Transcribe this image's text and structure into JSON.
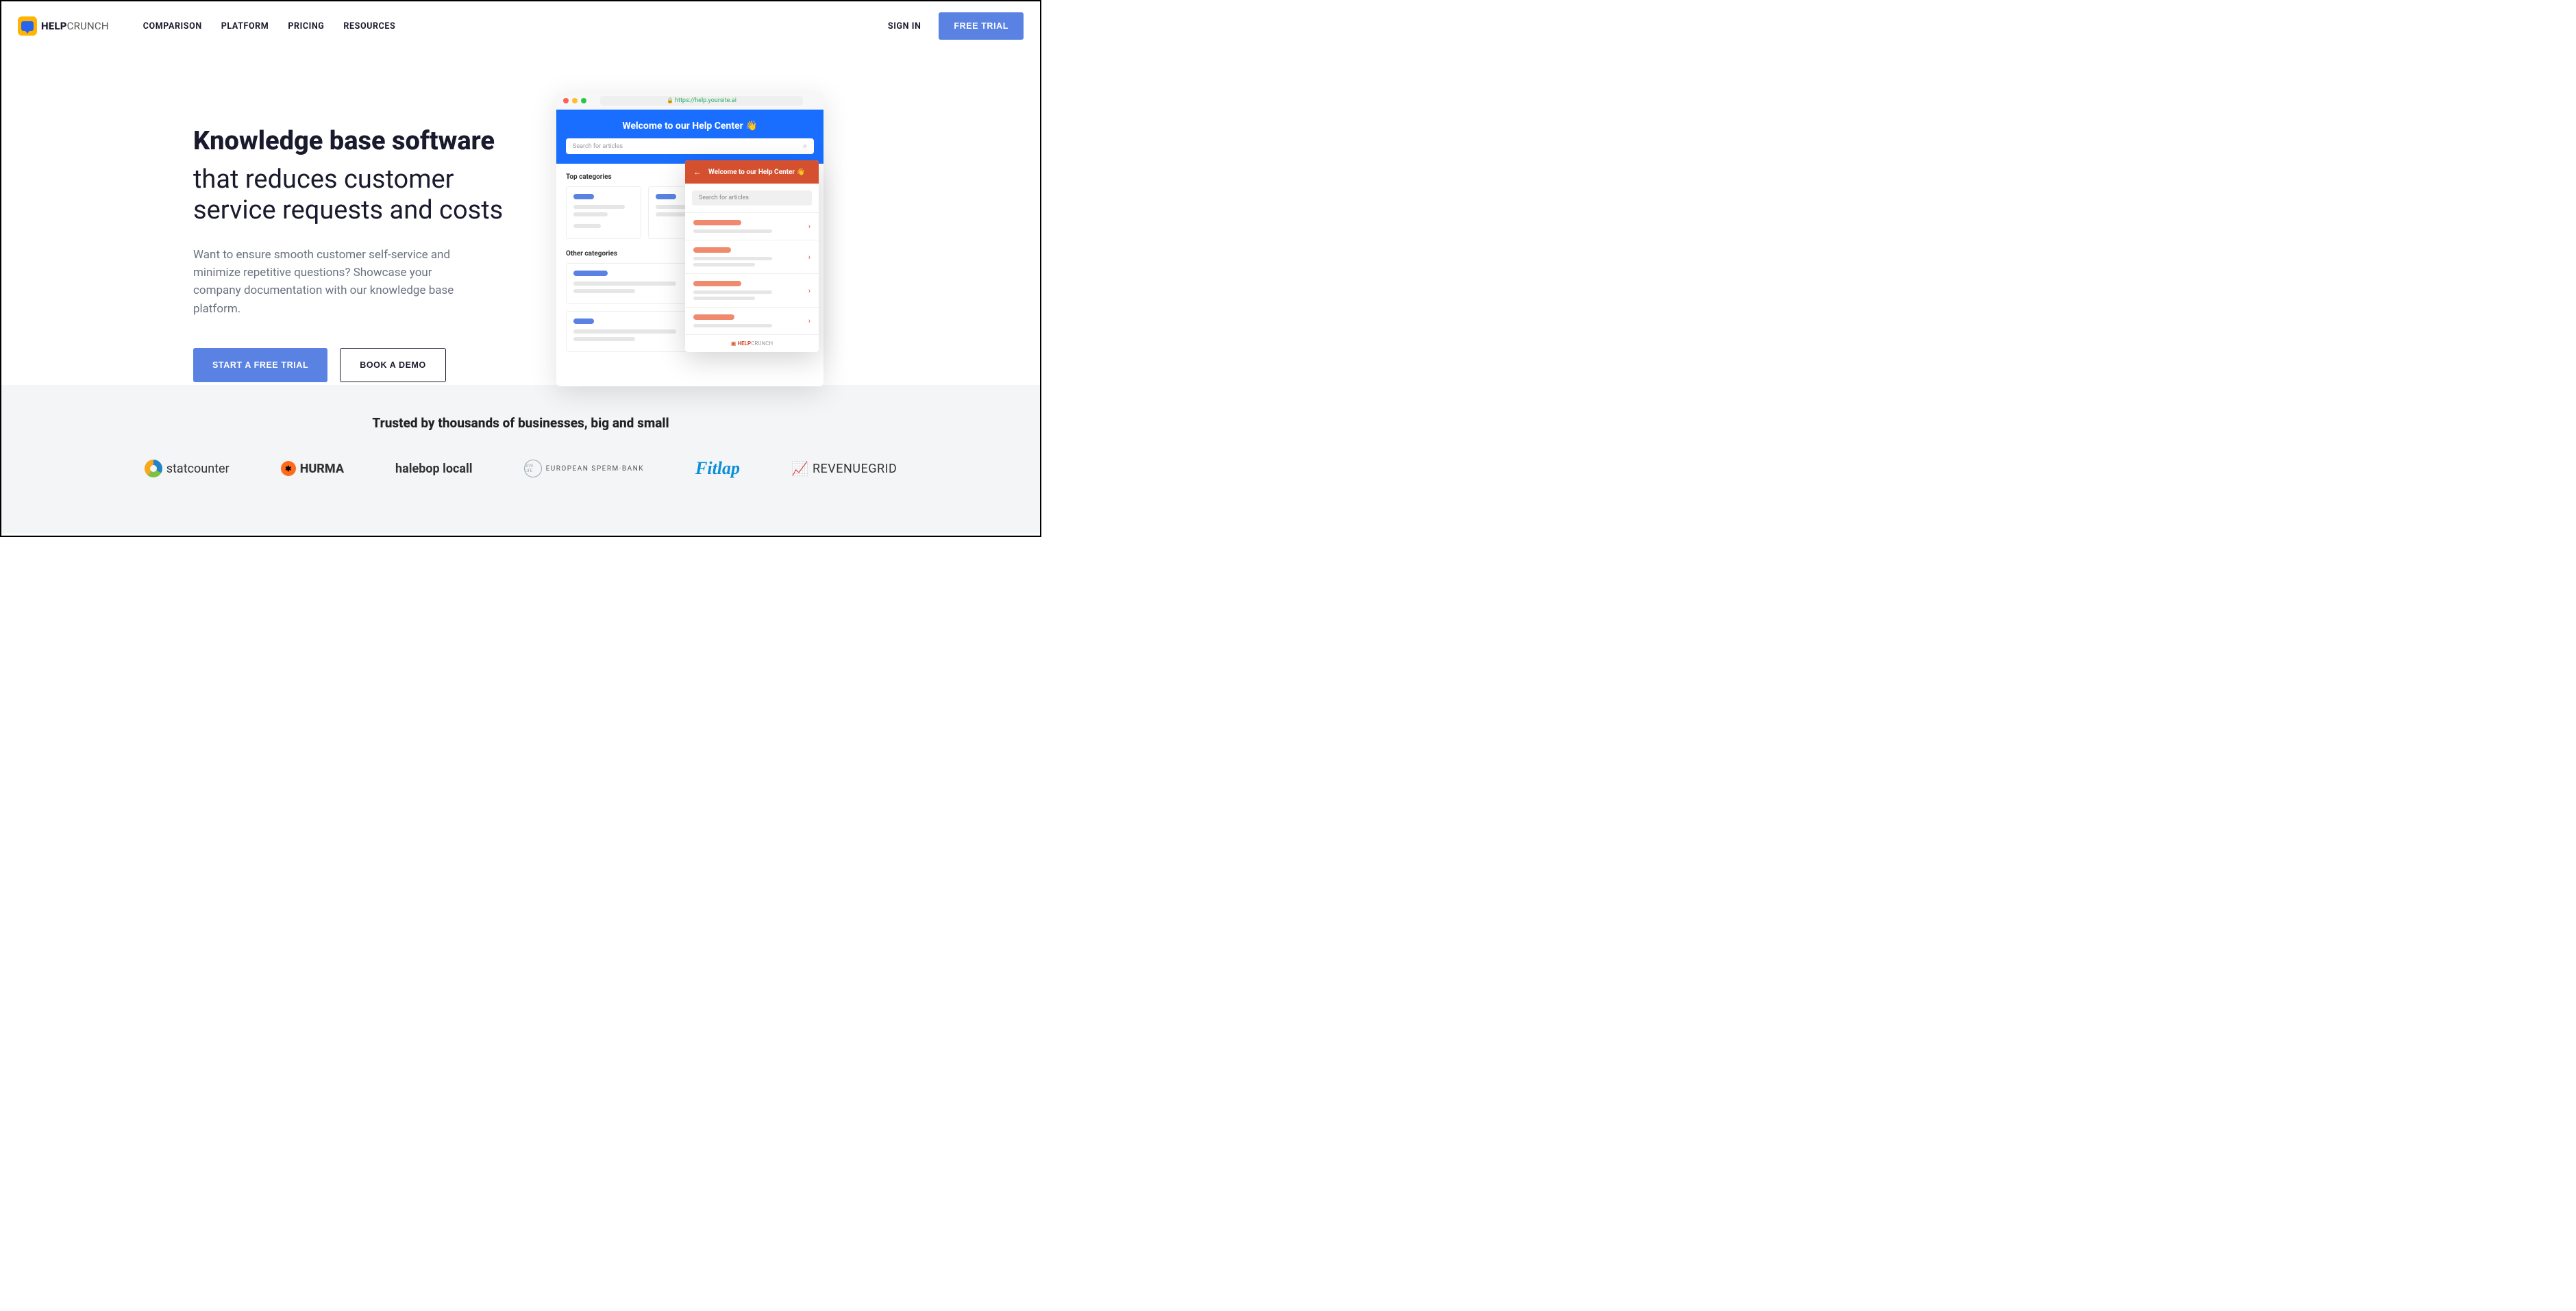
{
  "logo": {
    "bold": "HELP",
    "light": "CRUNCH"
  },
  "nav": {
    "comparison": "COMPARISON",
    "platform": "PLATFORM",
    "pricing": "PRICING",
    "resources": "RESOURCES"
  },
  "header": {
    "signin": "SIGN IN",
    "free_trial": "FREE TRIAL"
  },
  "hero": {
    "title": "Knowledge base software",
    "subtitle": "that reduces customer service requests and costs",
    "body": "Want to ensure smooth customer self-service and minimize repetitive questions? Showcase your company documentation with our knowledge base platform.",
    "cta_primary": "START A FREE TRIAL",
    "cta_secondary": "BOOK A DEMO"
  },
  "illustration": {
    "url": "https://help.yoursite.ai",
    "help_center_title": "Welcome to our Help Center 👋",
    "search_placeholder": "Search for articles",
    "top_label": "Top categories",
    "other_label": "Other categories",
    "popup_title": "Welcome to our Help Center 👋",
    "popup_search": "Search for articles",
    "popup_footer_bold": "HELP",
    "popup_footer_light": "CRUNCH"
  },
  "trusted": {
    "heading": "Trusted by thousands of businesses, big and small",
    "logos": {
      "statcounter": "statcounter",
      "hurma": "HURMA",
      "halebop": "halebop locall",
      "spermbank": "EUROPEAN SPERM·BANK",
      "fitlap": "Fitlap",
      "revenuegrid": "REVENUEGRID"
    }
  }
}
